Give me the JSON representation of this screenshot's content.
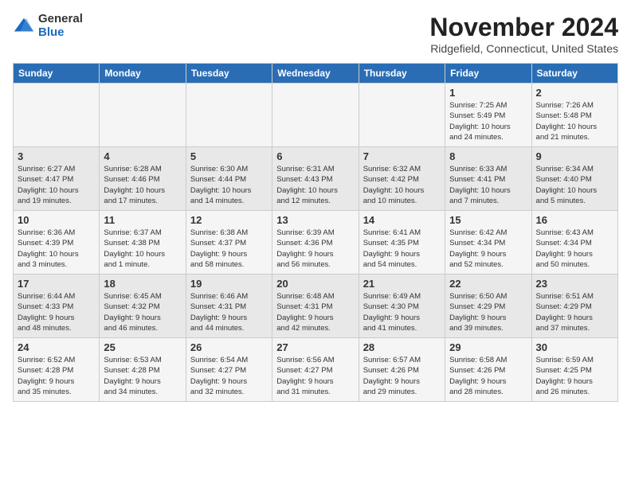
{
  "header": {
    "logo_general": "General",
    "logo_blue": "Blue",
    "month_title": "November 2024",
    "location": "Ridgefield, Connecticut, United States"
  },
  "days_of_week": [
    "Sunday",
    "Monday",
    "Tuesday",
    "Wednesday",
    "Thursday",
    "Friday",
    "Saturday"
  ],
  "weeks": [
    [
      {
        "day": "",
        "content": ""
      },
      {
        "day": "",
        "content": ""
      },
      {
        "day": "",
        "content": ""
      },
      {
        "day": "",
        "content": ""
      },
      {
        "day": "",
        "content": ""
      },
      {
        "day": "1",
        "content": "Sunrise: 7:25 AM\nSunset: 5:49 PM\nDaylight: 10 hours\nand 24 minutes."
      },
      {
        "day": "2",
        "content": "Sunrise: 7:26 AM\nSunset: 5:48 PM\nDaylight: 10 hours\nand 21 minutes."
      }
    ],
    [
      {
        "day": "3",
        "content": "Sunrise: 6:27 AM\nSunset: 4:47 PM\nDaylight: 10 hours\nand 19 minutes."
      },
      {
        "day": "4",
        "content": "Sunrise: 6:28 AM\nSunset: 4:46 PM\nDaylight: 10 hours\nand 17 minutes."
      },
      {
        "day": "5",
        "content": "Sunrise: 6:30 AM\nSunset: 4:44 PM\nDaylight: 10 hours\nand 14 minutes."
      },
      {
        "day": "6",
        "content": "Sunrise: 6:31 AM\nSunset: 4:43 PM\nDaylight: 10 hours\nand 12 minutes."
      },
      {
        "day": "7",
        "content": "Sunrise: 6:32 AM\nSunset: 4:42 PM\nDaylight: 10 hours\nand 10 minutes."
      },
      {
        "day": "8",
        "content": "Sunrise: 6:33 AM\nSunset: 4:41 PM\nDaylight: 10 hours\nand 7 minutes."
      },
      {
        "day": "9",
        "content": "Sunrise: 6:34 AM\nSunset: 4:40 PM\nDaylight: 10 hours\nand 5 minutes."
      }
    ],
    [
      {
        "day": "10",
        "content": "Sunrise: 6:36 AM\nSunset: 4:39 PM\nDaylight: 10 hours\nand 3 minutes."
      },
      {
        "day": "11",
        "content": "Sunrise: 6:37 AM\nSunset: 4:38 PM\nDaylight: 10 hours\nand 1 minute."
      },
      {
        "day": "12",
        "content": "Sunrise: 6:38 AM\nSunset: 4:37 PM\nDaylight: 9 hours\nand 58 minutes."
      },
      {
        "day": "13",
        "content": "Sunrise: 6:39 AM\nSunset: 4:36 PM\nDaylight: 9 hours\nand 56 minutes."
      },
      {
        "day": "14",
        "content": "Sunrise: 6:41 AM\nSunset: 4:35 PM\nDaylight: 9 hours\nand 54 minutes."
      },
      {
        "day": "15",
        "content": "Sunrise: 6:42 AM\nSunset: 4:34 PM\nDaylight: 9 hours\nand 52 minutes."
      },
      {
        "day": "16",
        "content": "Sunrise: 6:43 AM\nSunset: 4:34 PM\nDaylight: 9 hours\nand 50 minutes."
      }
    ],
    [
      {
        "day": "17",
        "content": "Sunrise: 6:44 AM\nSunset: 4:33 PM\nDaylight: 9 hours\nand 48 minutes."
      },
      {
        "day": "18",
        "content": "Sunrise: 6:45 AM\nSunset: 4:32 PM\nDaylight: 9 hours\nand 46 minutes."
      },
      {
        "day": "19",
        "content": "Sunrise: 6:46 AM\nSunset: 4:31 PM\nDaylight: 9 hours\nand 44 minutes."
      },
      {
        "day": "20",
        "content": "Sunrise: 6:48 AM\nSunset: 4:31 PM\nDaylight: 9 hours\nand 42 minutes."
      },
      {
        "day": "21",
        "content": "Sunrise: 6:49 AM\nSunset: 4:30 PM\nDaylight: 9 hours\nand 41 minutes."
      },
      {
        "day": "22",
        "content": "Sunrise: 6:50 AM\nSunset: 4:29 PM\nDaylight: 9 hours\nand 39 minutes."
      },
      {
        "day": "23",
        "content": "Sunrise: 6:51 AM\nSunset: 4:29 PM\nDaylight: 9 hours\nand 37 minutes."
      }
    ],
    [
      {
        "day": "24",
        "content": "Sunrise: 6:52 AM\nSunset: 4:28 PM\nDaylight: 9 hours\nand 35 minutes."
      },
      {
        "day": "25",
        "content": "Sunrise: 6:53 AM\nSunset: 4:28 PM\nDaylight: 9 hours\nand 34 minutes."
      },
      {
        "day": "26",
        "content": "Sunrise: 6:54 AM\nSunset: 4:27 PM\nDaylight: 9 hours\nand 32 minutes."
      },
      {
        "day": "27",
        "content": "Sunrise: 6:56 AM\nSunset: 4:27 PM\nDaylight: 9 hours\nand 31 minutes."
      },
      {
        "day": "28",
        "content": "Sunrise: 6:57 AM\nSunset: 4:26 PM\nDaylight: 9 hours\nand 29 minutes."
      },
      {
        "day": "29",
        "content": "Sunrise: 6:58 AM\nSunset: 4:26 PM\nDaylight: 9 hours\nand 28 minutes."
      },
      {
        "day": "30",
        "content": "Sunrise: 6:59 AM\nSunset: 4:25 PM\nDaylight: 9 hours\nand 26 minutes."
      }
    ]
  ]
}
